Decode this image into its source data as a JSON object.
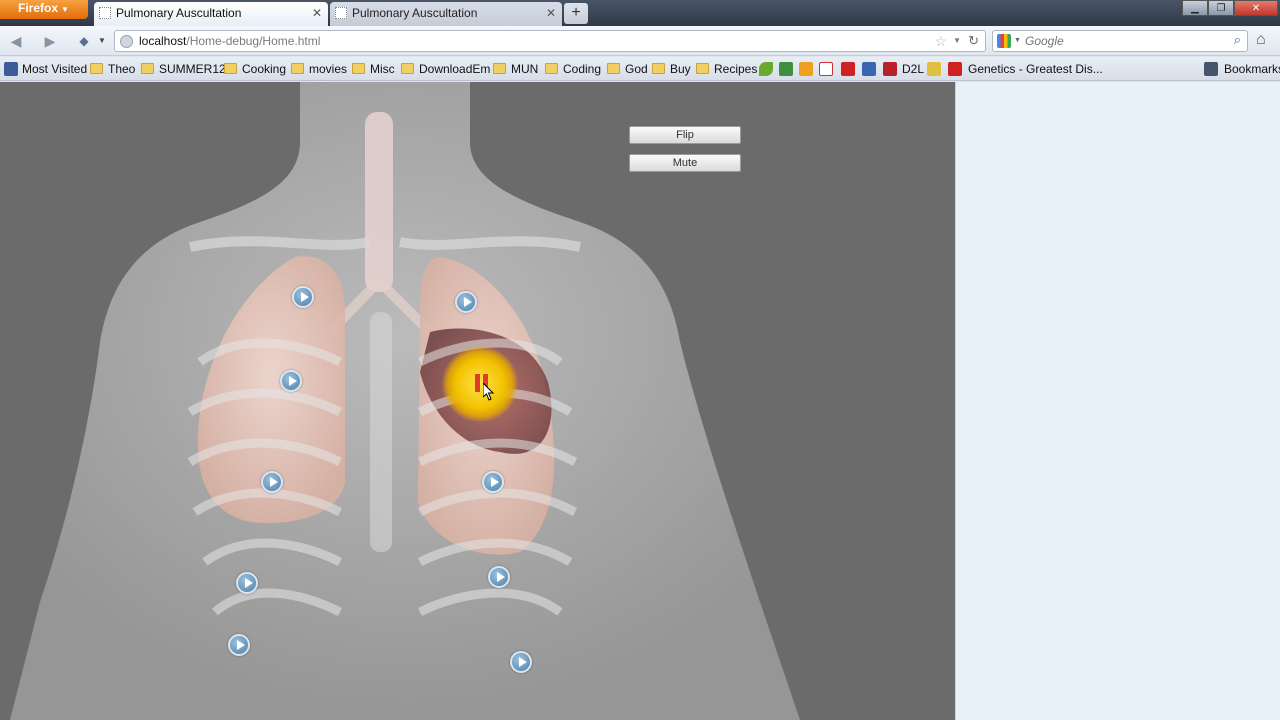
{
  "browser": {
    "app_button": "Firefox",
    "tabs": [
      {
        "title": "Pulmonary Auscultation",
        "active": true
      },
      {
        "title": "Pulmonary Auscultation",
        "active": false
      }
    ],
    "new_tab": "+",
    "url_host": "localhost",
    "url_path": "/Home-debug/Home.html",
    "search_placeholder": "Google",
    "bookmarks": [
      {
        "label": "Most Visited"
      },
      {
        "label": "Theo"
      },
      {
        "label": "SUMMER12"
      },
      {
        "label": "Cooking"
      },
      {
        "label": "movies"
      },
      {
        "label": "Misc"
      },
      {
        "label": "DownloadEm"
      },
      {
        "label": "MUN"
      },
      {
        "label": "Coding"
      },
      {
        "label": "God"
      },
      {
        "label": "Buy"
      },
      {
        "label": "Recipes"
      },
      {
        "label": "D2L"
      },
      {
        "label": "Genetics - Greatest Dis..."
      }
    ],
    "bookmarks_menu": "Bookmarks"
  },
  "app": {
    "flip_label": "Flip",
    "mute_label": "Mute",
    "auscultation_points": 11,
    "active_point": "left upper lobe (playing)"
  },
  "colors": {
    "viewport_bg": "#6b6b6b",
    "side_panel_bg": "#e8f0f8",
    "active_glow": "#f2c200",
    "spot_blue": "#4b7ea8"
  }
}
